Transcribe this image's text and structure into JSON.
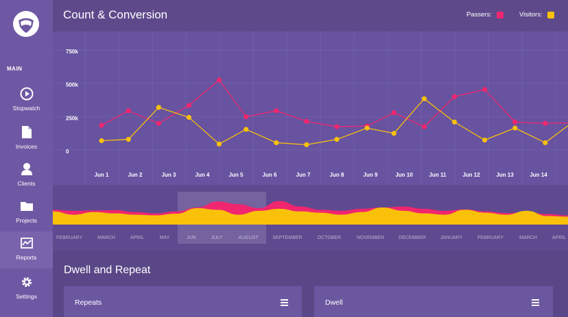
{
  "sidebar": {
    "section_label": "MAIN",
    "items": [
      {
        "label": "Stopwatch",
        "icon": "play-circle-icon",
        "active": false
      },
      {
        "label": "Invoices",
        "icon": "document-icon",
        "active": false
      },
      {
        "label": "Clients",
        "icon": "person-icon",
        "active": false
      },
      {
        "label": "Projects",
        "icon": "folder-icon",
        "active": false
      },
      {
        "label": "Reports",
        "icon": "chart-icon",
        "active": true
      },
      {
        "label": "Settings",
        "icon": "gear-icon",
        "active": false
      }
    ]
  },
  "header": {
    "title": "Count & Conversion",
    "legend": [
      {
        "label": "Passers:",
        "color": "#f0266f"
      },
      {
        "label": "Visitors:",
        "color": "#f9c10a"
      }
    ]
  },
  "chart_data": [
    {
      "type": "line",
      "title": "Count & Conversion",
      "x": [
        "Jun 1",
        "Jun 2",
        "Jun 3",
        "Jun 4",
        "Jun 5",
        "Jun 6",
        "Jun 7",
        "Jun 8",
        "Jun 9",
        "Jun 10",
        "Jun 11",
        "Jun 12",
        "Jun 13",
        "Jun 14"
      ],
      "y_ticks": [
        "750k",
        "500k",
        "250k",
        "0"
      ],
      "ylim": [
        0,
        750000
      ],
      "grid": true,
      "legend_position": "top-right",
      "series": [
        {
          "name": "Passers",
          "color": "#f0266f",
          "x_points": [
            0.0,
            0.8,
            1.7,
            2.6,
            3.5,
            4.3,
            5.2,
            6.1,
            7.0,
            7.9,
            8.7,
            9.6,
            10.5,
            11.4,
            12.3,
            13.2,
            14.1
          ],
          "values": [
            210000,
            320000,
            225000,
            360000,
            550000,
            275000,
            320000,
            240000,
            200000,
            205000,
            305000,
            200000,
            425000,
            480000,
            235000,
            225000,
            230000
          ]
        },
        {
          "name": "Visitors",
          "color": "#f9c10a",
          "x_points": [
            0.0,
            0.8,
            1.7,
            2.6,
            3.5,
            4.3,
            5.2,
            6.1,
            7.0,
            7.9,
            8.7,
            9.6,
            10.5,
            11.4,
            12.3,
            13.2,
            14.1
          ],
          "values": [
            95000,
            105000,
            345000,
            270000,
            70000,
            180000,
            80000,
            65000,
            105000,
            190000,
            150000,
            410000,
            235000,
            100000,
            190000,
            80000,
            250000
          ]
        }
      ]
    },
    {
      "type": "area",
      "categories": [
        "FEBRUARY",
        "MARCH",
        "APRIL",
        "MAY",
        "JUN",
        "JULY",
        "AUGUST",
        "SEPTEMBER",
        "OCTOBER",
        "NOVEMBER",
        "DECEMBER",
        "JANUARY",
        "FEBRUARY",
        "MARCH",
        "APRIL"
      ],
      "selected_range": [
        "JUN",
        "AUGUST"
      ],
      "series": [
        {
          "name": "Passers",
          "color": "#f0266f",
          "values": [
            0.45,
            0.42,
            0.43,
            0.44,
            0.38,
            0.34,
            0.4,
            0.52,
            0.7,
            0.62,
            0.5,
            0.72,
            0.55,
            0.45,
            0.42,
            0.48,
            0.52,
            0.55,
            0.48,
            0.42,
            0.46,
            0.4,
            0.35,
            0.38,
            0.32,
            0.28
          ]
        },
        {
          "name": "Visitors",
          "color": "#f9c10a",
          "values": [
            0.4,
            0.3,
            0.38,
            0.34,
            0.3,
            0.28,
            0.33,
            0.5,
            0.45,
            0.3,
            0.42,
            0.48,
            0.4,
            0.36,
            0.3,
            0.38,
            0.52,
            0.42,
            0.34,
            0.3,
            0.45,
            0.36,
            0.3,
            0.42,
            0.26,
            0.24
          ]
        }
      ]
    }
  ],
  "section": {
    "title": "Dwell and Repeat",
    "cards": [
      {
        "title": "Repeats"
      },
      {
        "title": "Dwell"
      }
    ]
  }
}
